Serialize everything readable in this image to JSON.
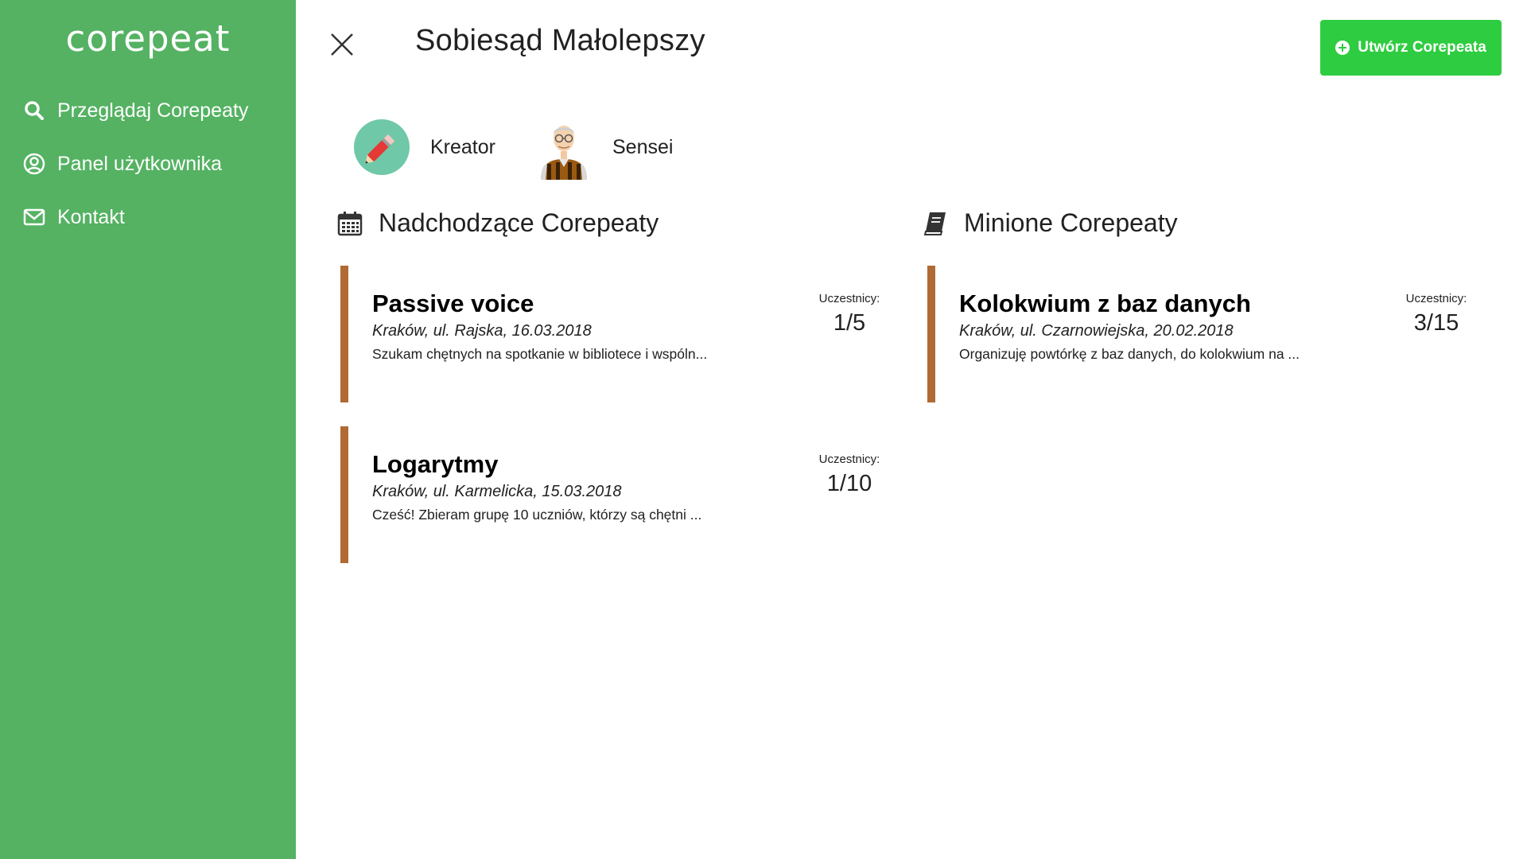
{
  "app": {
    "logo": "corepeat"
  },
  "sidebar": {
    "items": [
      {
        "label": "Przeglądaj Corepeaty",
        "icon": "search-icon"
      },
      {
        "label": "Panel użytkownika",
        "icon": "user-circle-icon"
      },
      {
        "label": "Kontakt",
        "icon": "envelope-icon"
      }
    ]
  },
  "header": {
    "title": "Sobiesąd Małolepszy",
    "create_button": "Utwórz Corepeata"
  },
  "badges": [
    {
      "label": "Kreator",
      "icon": "pencil-icon"
    },
    {
      "label": "Sensei",
      "icon": "sensei-avatar-icon"
    }
  ],
  "sections": {
    "upcoming": {
      "title": "Nadchodzące Corepeaty",
      "icon": "calendar-icon",
      "cards": [
        {
          "title": "Passive voice",
          "meta": "Kraków, ul. Rajska, 16.03.2018",
          "desc": "Szukam chętnych na spotkanie w bibliotece i wspóln...",
          "participants_label": "Uczestnicy:",
          "participants": "1/5"
        },
        {
          "title": "Logarytmy",
          "meta": "Kraków, ul. Karmelicka, 15.03.2018",
          "desc": "Cześć! Zbieram grupę 10 uczniów, którzy są chętni ...",
          "participants_label": "Uczestnicy:",
          "participants": "1/10"
        }
      ]
    },
    "past": {
      "title": "Minione Corepeaty",
      "icon": "book-icon",
      "cards": [
        {
          "title": "Kolokwium z baz danych",
          "meta": "Kraków, ul. Czarnowiejska, 20.02.2018",
          "desc": "Organizuję powtórkę z baz danych, do kolokwium na ...",
          "participants_label": "Uczestnicy:",
          "participants": "3/15"
        }
      ]
    }
  },
  "colors": {
    "sidebar": "#54b262",
    "accent_button": "#2ecc40",
    "card_border": "#b06a33"
  }
}
